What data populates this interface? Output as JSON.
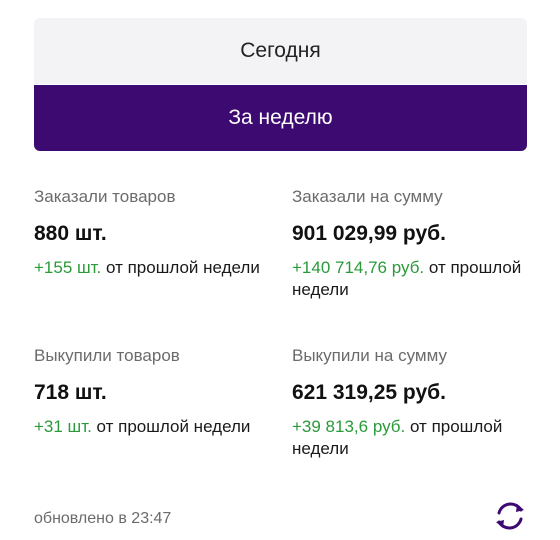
{
  "tabs": {
    "today": "Сегодня",
    "week": "За неделю"
  },
  "stats": {
    "ordered_items": {
      "label": "Заказали товаров",
      "value": "880 шт.",
      "delta": "+155 шт.",
      "suffix": " от прошлой недели"
    },
    "ordered_sum": {
      "label": "Заказали на сумму",
      "value": "901 029,99 руб.",
      "delta": "+140 714,76 руб.",
      "suffix": " от прошлой недели"
    },
    "bought_items": {
      "label": "Выкупили товаров",
      "value": "718 шт.",
      "delta": "+31 шт.",
      "suffix": " от прошлой недели"
    },
    "bought_sum": {
      "label": "Выкупили на сумму",
      "value": "621 319,25 руб.",
      "delta": "+39 813,6 руб.",
      "suffix": " от прошлой недели"
    }
  },
  "footer": {
    "updated": "обновлено в 23:47"
  },
  "colors": {
    "accent": "#3d0a72",
    "positive": "#2a9a3a"
  },
  "icons": {
    "refresh": "refresh-icon"
  }
}
